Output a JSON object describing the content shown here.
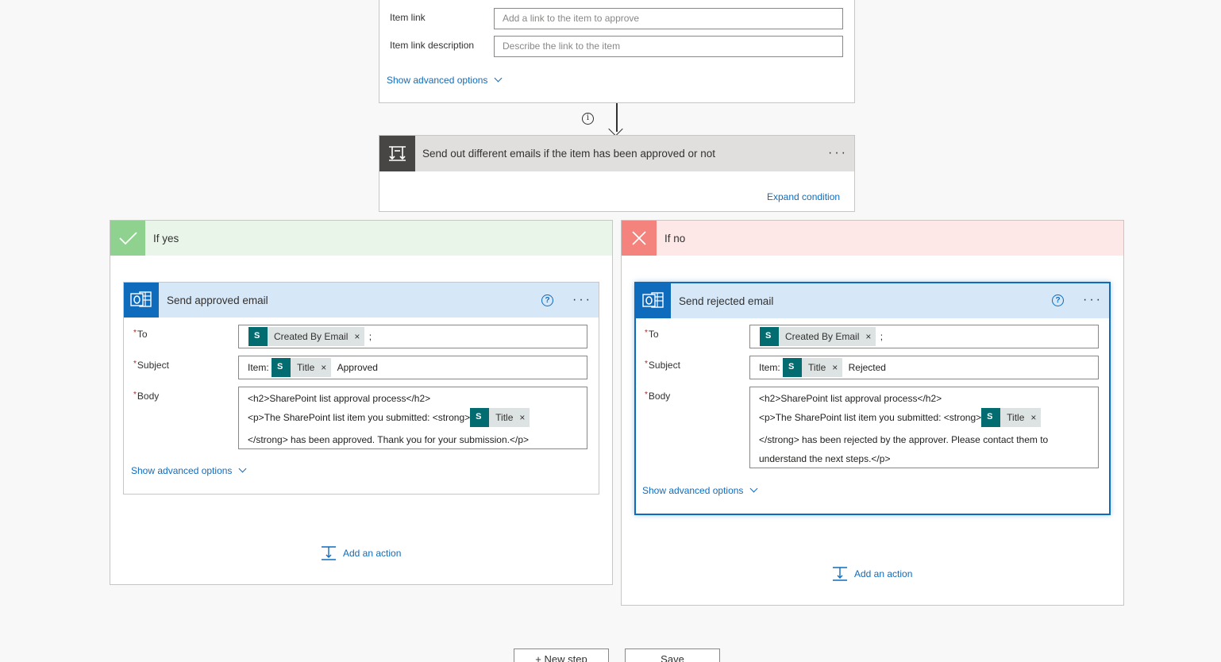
{
  "top_card": {
    "item_link_label": "Item link",
    "item_link_placeholder": "Add a link to the item to approve",
    "item_link_desc_label": "Item link description",
    "item_link_desc_placeholder": "Describe the link to the item",
    "show_advanced": "Show advanced options"
  },
  "condition": {
    "title": "Send out different emails if the item has been approved or not",
    "expand": "Expand condition",
    "more": "···",
    "info": "i"
  },
  "yes_branch": {
    "label": "If yes",
    "color": "#e9f5e9",
    "icon_color": "#8fd18f",
    "action": {
      "title": "Send approved email",
      "more": "···",
      "help": "?",
      "to_label": "To",
      "to_token": "Created By Email",
      "to_suffix": ";",
      "subject_label": "Subject",
      "subject_prefix": "Item:",
      "subject_token": "Title",
      "subject_suffix": "Approved",
      "body_label": "Body",
      "body_line1": "<h2>SharePoint list approval process</h2>",
      "body_line2": "<p>The SharePoint list item you submitted: <strong>",
      "body_token": "Title",
      "body_line3": "</strong> has been approved. Thank you for your submission.</p>",
      "show_advanced": "Show advanced options"
    },
    "add_action": "Add an action"
  },
  "no_branch": {
    "label": "If no",
    "color": "#fde7e7",
    "icon_color": "#f4837d",
    "action": {
      "title": "Send rejected email",
      "more": "···",
      "help": "?",
      "to_label": "To",
      "to_token": "Created By Email",
      "to_suffix": ";",
      "subject_label": "Subject",
      "subject_prefix": "Item:",
      "subject_token": "Title",
      "subject_suffix": "Rejected",
      "body_label": "Body",
      "body_line1": "<h2>SharePoint list approval process</h2>",
      "body_line2": "<p>The SharePoint list item you submitted: <strong>",
      "body_token": "Title",
      "body_line3": "</strong> has been rejected by the approver. Please contact them to",
      "body_line4": "understand the next steps.</p>",
      "show_advanced": "Show advanced options"
    },
    "add_action": "Add an action"
  },
  "bottom": {
    "new_step": "+ New step",
    "save": "Save"
  },
  "token_remove": "×",
  "colors": {
    "accent": "#0f6cbd",
    "sharepoint": "#036c70",
    "action_header": "#d6e7f7"
  }
}
